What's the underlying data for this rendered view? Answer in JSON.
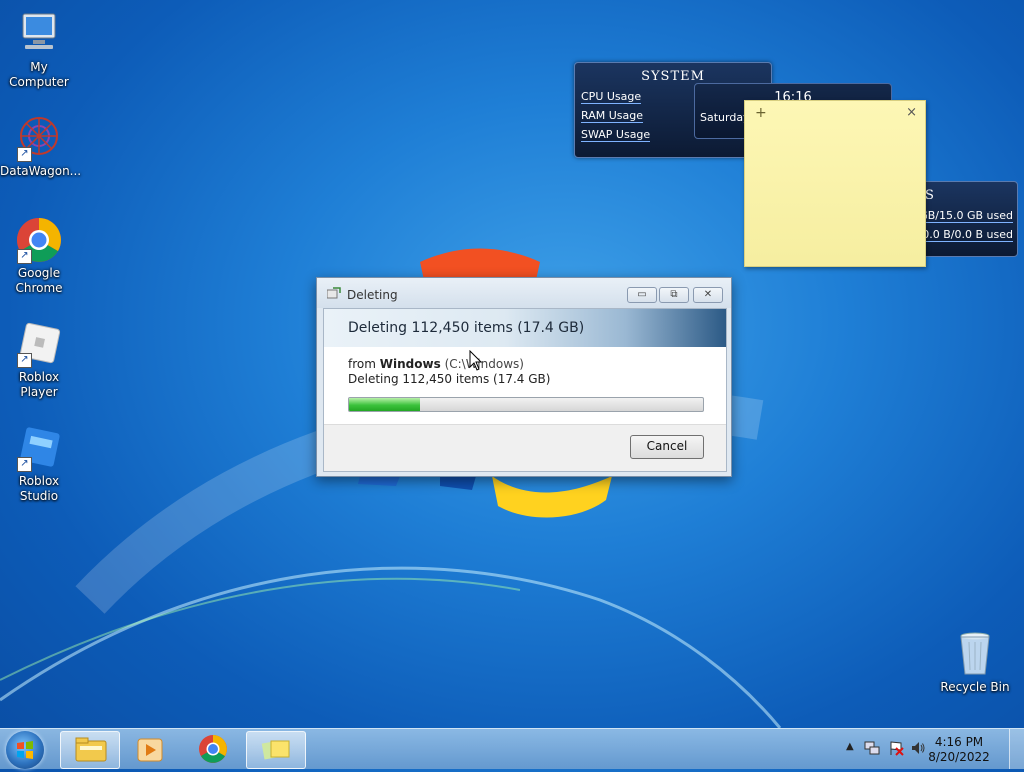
{
  "desktop": {
    "icons": [
      {
        "label": "My Computer"
      },
      {
        "label": "DataWagon..."
      },
      {
        "label": "Google Chrome"
      },
      {
        "label": "Roblox Player"
      },
      {
        "label": "Roblox Studio"
      }
    ],
    "recycle_bin": {
      "label": "Recycle Bin"
    }
  },
  "gadgets": {
    "system": {
      "title": "SYSTEM",
      "rows": [
        "CPU Usage",
        "RAM Usage",
        "SWAP Usage"
      ]
    },
    "clock": {
      "time": "16:16",
      "day": "Saturday"
    },
    "disk": {
      "title": "S",
      "rows": [
        "GB/15.0 GB used",
        "0.0 B/0.0 B used"
      ]
    },
    "sticky_note": {
      "add": "+",
      "close": "×"
    }
  },
  "dialog": {
    "title": "Deleting",
    "heading": "Deleting 112,450 items (17.4 GB)",
    "from_prefix": "from",
    "from_name": "Windows",
    "from_path": "(C:\\Windows)",
    "detail": "Deleting 112,450 items (17.4 GB)",
    "progress_percent": 20,
    "cancel_label": "Cancel"
  },
  "taskbar": {
    "clock_time": "4:16 PM",
    "clock_date": "8/20/2022",
    "tray_icons": [
      "show-hidden-icons-arrow",
      "network-icon",
      "action-center-flag-icon",
      "volume-icon"
    ]
  }
}
